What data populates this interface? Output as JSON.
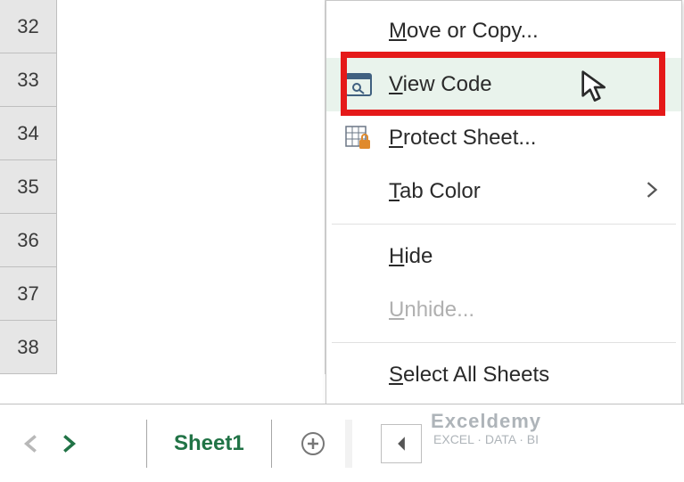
{
  "rows": [
    "32",
    "33",
    "34",
    "35",
    "36",
    "37",
    "38"
  ],
  "menu": {
    "moveCopy": "Move or Copy...",
    "viewCode": "View Code",
    "protectSheet": "Protect Sheet...",
    "tabColor": "Tab Color",
    "hide": "Hide",
    "unhide": "Unhide...",
    "selectAll": "Select All Sheets"
  },
  "sheet": {
    "name": "Sheet1"
  },
  "watermark": {
    "brand": "Exceldemy",
    "tag": "EXCEL · DATA · BI"
  }
}
